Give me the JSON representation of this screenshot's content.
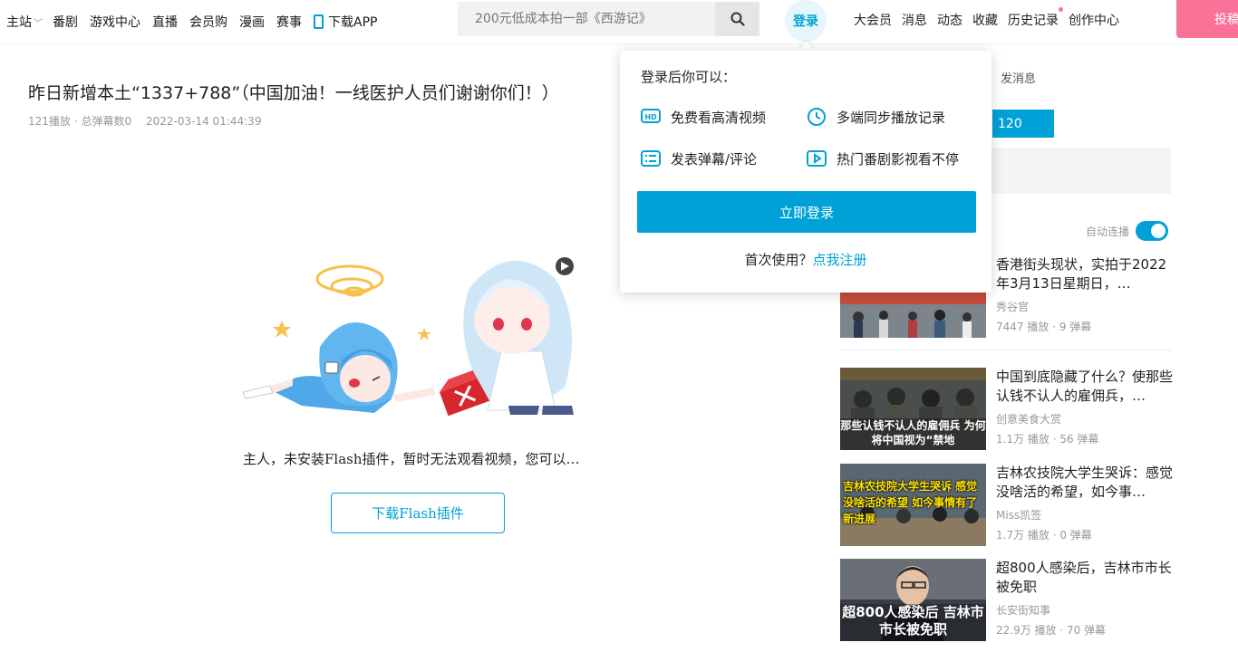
{
  "nav": {
    "main_label": "主站",
    "items": [
      "番剧",
      "游戏中心",
      "直播",
      "会员购",
      "漫画",
      "赛事"
    ],
    "download_app": "下载APP",
    "search_placeholder": "200元低成本拍一部《西游记》",
    "login": "登录",
    "right_items": [
      "大会员",
      "消息",
      "动态",
      "收藏",
      "历史记录",
      "创作中心"
    ],
    "upload": "投稿"
  },
  "video": {
    "title": "昨日新增本土“1337+788”（中国加油！一线医护人员们谢谢你们！）",
    "views": "121播放",
    "danmaku": "· 总弹幕数0",
    "date": "2022-03-14 01:44:39"
  },
  "player": {
    "flash_message": "主人，未安装Flash插件，暂时无法观看视频，您可以…",
    "flash_button": "下载Flash插件"
  },
  "sidebar": {
    "send_message": "发消息",
    "bar_value": "120",
    "autoplay_label": "自动连播",
    "autoplay_on": true,
    "recommendations": [
      {
        "title": "香港街头现状，实拍于2022年3月13日星期日，…",
        "author": "秀谷官",
        "stats": "7447 播放 · 9 弹幕",
        "thumb_text": ""
      },
      {
        "title": "中国到底隐藏了什么？使那些认钱不认人的雇佣兵，…",
        "author": "创意美食大赏",
        "stats": "1.1万 播放 · 56 弹幕",
        "thumb_text": "那些认钱不认人的雇佣兵 为何将中国视为“禁地"
      },
      {
        "title": "吉林农技院大学生哭诉：感觉没啥活的希望，如今事…",
        "author": "Miss凯签",
        "stats": "1.7万 播放 · 0 弹幕",
        "thumb_text": "吉林农技院大学生哭诉 感觉没啥活的希望 如今事情有了新进展"
      },
      {
        "title": "超800人感染后，吉林市市长被免职",
        "author": "长安街知事",
        "stats": "22.9万 播放 · 70 弹幕",
        "thumb_text": "超800人感染后 吉林市市长被免职"
      }
    ]
  },
  "login_popup": {
    "heading": "登录后你可以：",
    "features": [
      "免费看高清视频",
      "多端同步播放记录",
      "发表弹幕/评论",
      "热门番剧影视看不停"
    ],
    "login_button": "立即登录",
    "register_prompt": "首次使用？",
    "register_link": "点我注册"
  },
  "colors": {
    "brand": "#00a1d6",
    "pink": "#fb7299"
  }
}
